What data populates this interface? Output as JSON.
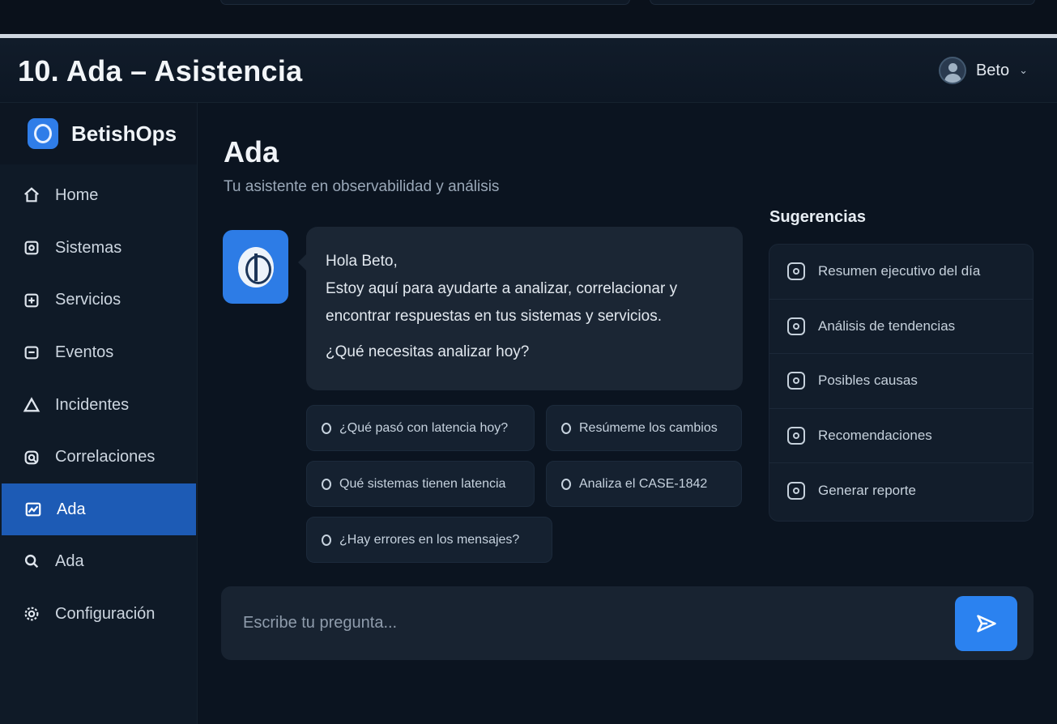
{
  "slide_title": "10. Ada – Asistencia",
  "user": {
    "name": "Beto"
  },
  "brand": {
    "name": "BetishOps"
  },
  "nav": [
    {
      "label": "Home",
      "icon": "home-icon"
    },
    {
      "label": "Sistemas",
      "icon": "systems-icon"
    },
    {
      "label": "Servicios",
      "icon": "services-icon"
    },
    {
      "label": "Eventos",
      "icon": "events-icon"
    },
    {
      "label": "Incidentes",
      "icon": "warning-icon"
    },
    {
      "label": "Correlaciones",
      "icon": "correlations-icon"
    },
    {
      "label": "Ada",
      "icon": "chart-icon",
      "active": true
    },
    {
      "label": "Ada",
      "icon": "search-icon"
    },
    {
      "label": "Configuración",
      "icon": "gear-icon"
    }
  ],
  "page": {
    "title": "Ada",
    "subtitle": "Tu asistente en observabilidad y análisis"
  },
  "message": {
    "greeting": "Hola Beto,",
    "line1": "Estoy aquí para ayudarte a analizar, correlacionar y",
    "line2": "encontrar respuestas en tus sistemas y servicios.",
    "question": "¿Qué necesitas analizar hoy?"
  },
  "chips": [
    "¿Qué pasó con latencia hoy?",
    "Resúmeme los cambios",
    "Qué sistemas tienen latencia",
    "Analiza el CASE-1842",
    "¿Hay errores en los mensajes?"
  ],
  "composer": {
    "placeholder": "Escribe tu pregunta..."
  },
  "suggestions": {
    "title": "Sugerencias",
    "items": [
      "Resumen ejecutivo del día",
      "Análisis de tendencias",
      "Posibles causas",
      "Recomendaciones",
      "Generar reporte"
    ]
  },
  "colors": {
    "accent": "#2b82f0",
    "active_nav": "#1d5bb5",
    "background": "#0b1420"
  }
}
